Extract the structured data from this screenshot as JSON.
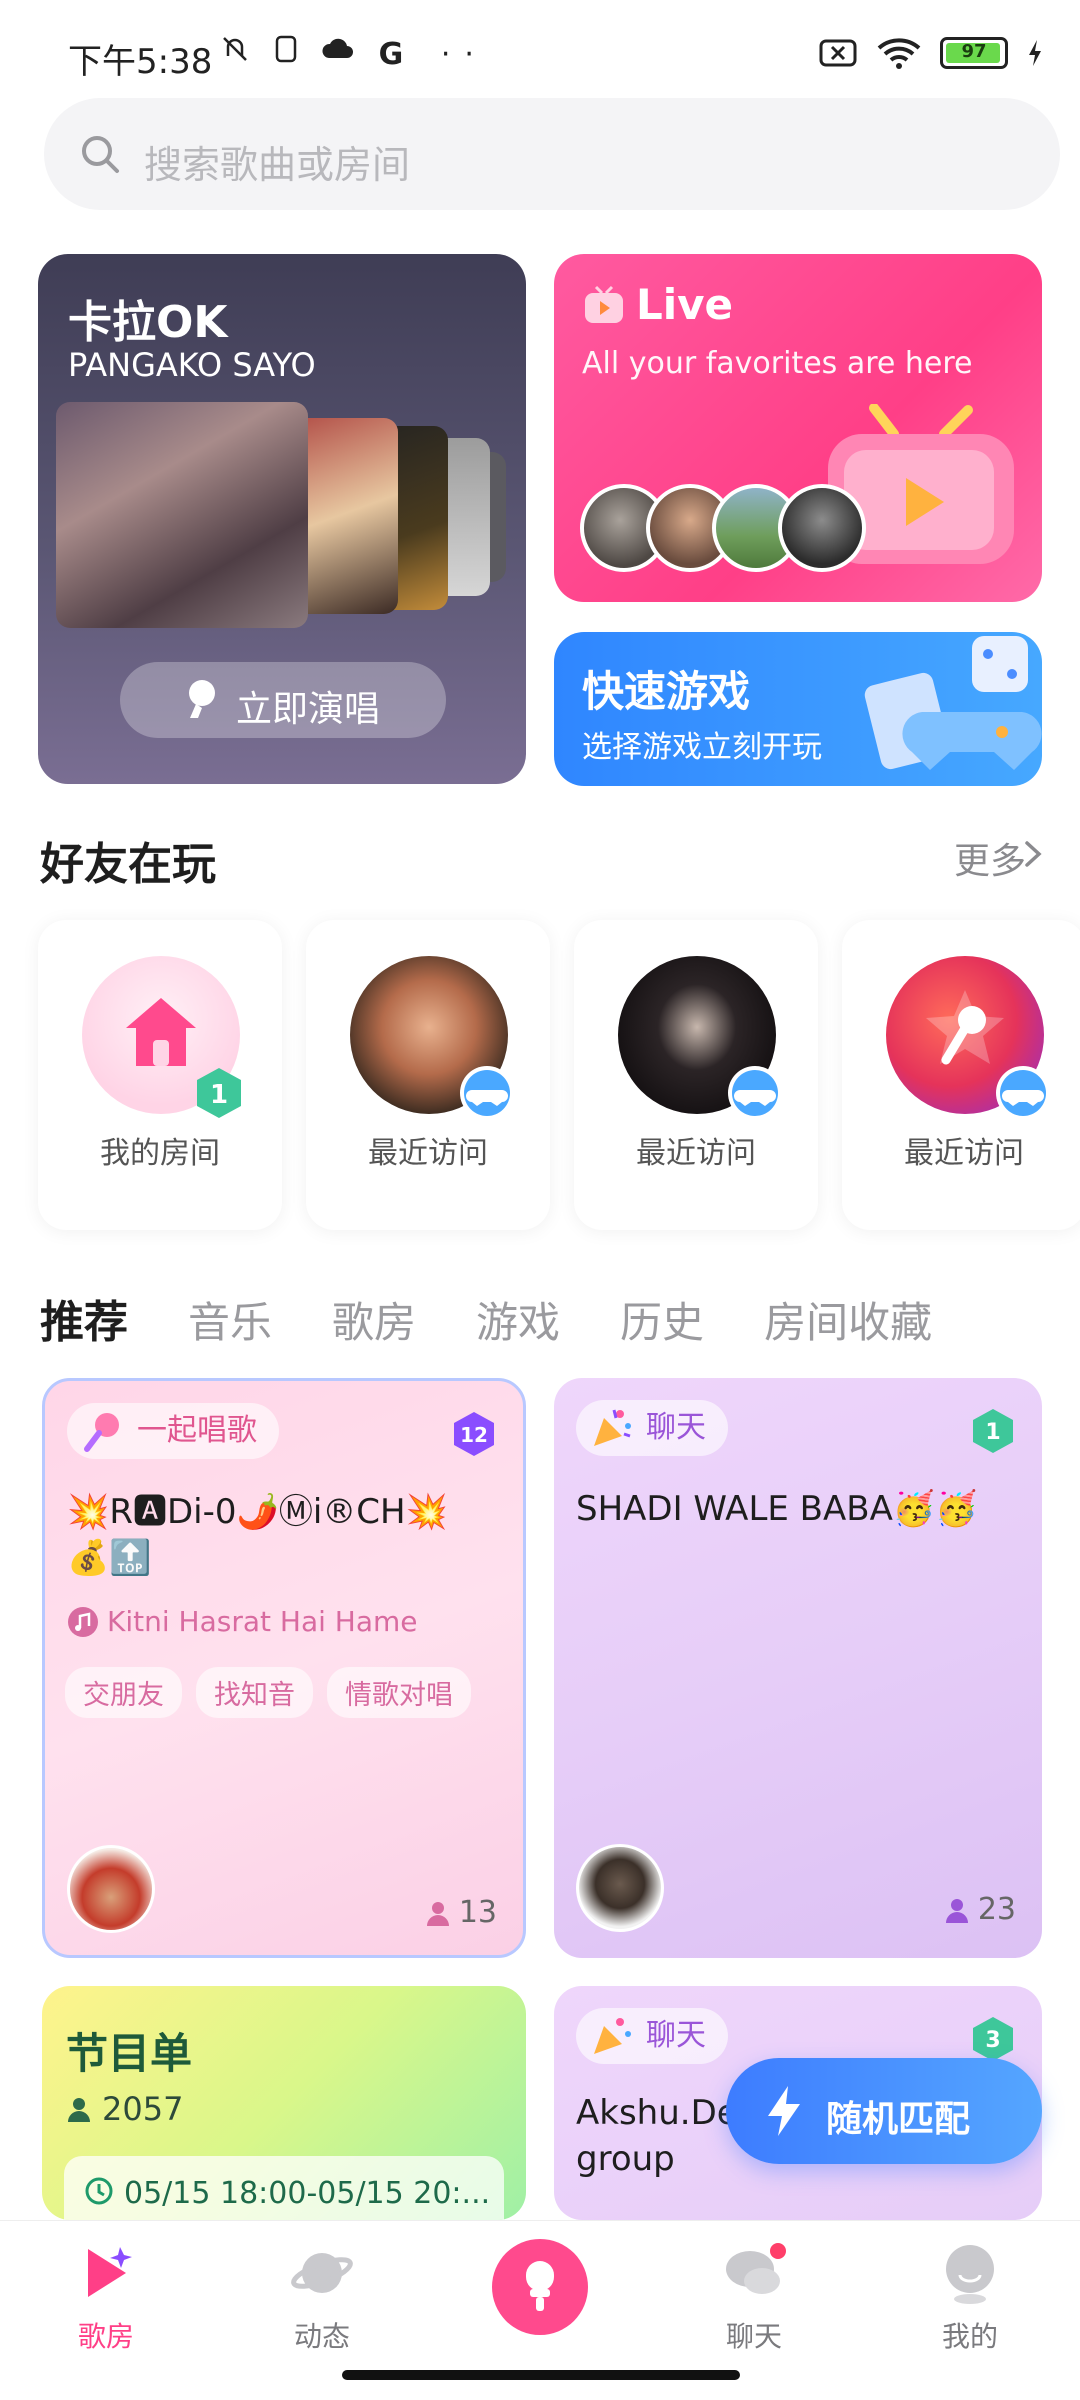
{
  "status_bar": {
    "time": "下午5:38",
    "battery": "97",
    "battery_level": 0.97
  },
  "search": {
    "placeholder": "搜索歌曲或房间"
  },
  "karaoke_card": {
    "title": "卡拉OK",
    "subtitle": "PANGAKO SAYO",
    "button_label": "立即演唱"
  },
  "live_card": {
    "title": "Live",
    "subtitle": "All your favorites are here"
  },
  "quick_game_card": {
    "title": "快速游戏",
    "subtitle": "选择游戏立刻开玩"
  },
  "friends_section": {
    "title": "好友在玩",
    "more_label": "更多",
    "items": [
      {
        "label": "我的房间",
        "icon": "home-icon",
        "level": "1"
      },
      {
        "label": "最近访问",
        "icon": "game-badge-icon"
      },
      {
        "label": "最近访问",
        "icon": "game-badge-icon"
      },
      {
        "label": "最近访问",
        "icon": "game-badge-icon"
      }
    ]
  },
  "tabs": [
    "推荐",
    "音乐",
    "歌房",
    "游戏",
    "历史",
    "房间收藏"
  ],
  "rooms": [
    {
      "tag": "一起唱歌",
      "level": "12",
      "name_line1": "💥R🅰Di-0🌶️Ⓜi®CH💥",
      "name_line2": "💰🔝",
      "song": "Kitni Hasrat Hai Hame",
      "chips": [
        "交朋友",
        "找知音",
        "情歌对唱"
      ],
      "count": "13"
    },
    {
      "tag": "聊天",
      "level": "1",
      "name_line1": "SHADI WALE BABA🥳🥳",
      "count": "23"
    },
    {
      "title": "节目单",
      "count": "2057",
      "schedule": "05/15 18:00-05/15 20:..."
    },
    {
      "tag": "聊天",
      "level": "3",
      "name_line1": "Akshu.De",
      "name_line2": "group"
    }
  ],
  "fab": {
    "label": "随机匹配"
  },
  "bottom_nav": [
    "歌房",
    "动态",
    "聊天",
    "我的"
  ],
  "colors": {
    "accent": "#ff3f87",
    "blue": "#3d7cff",
    "karaoke_bg": "#4a4762"
  }
}
